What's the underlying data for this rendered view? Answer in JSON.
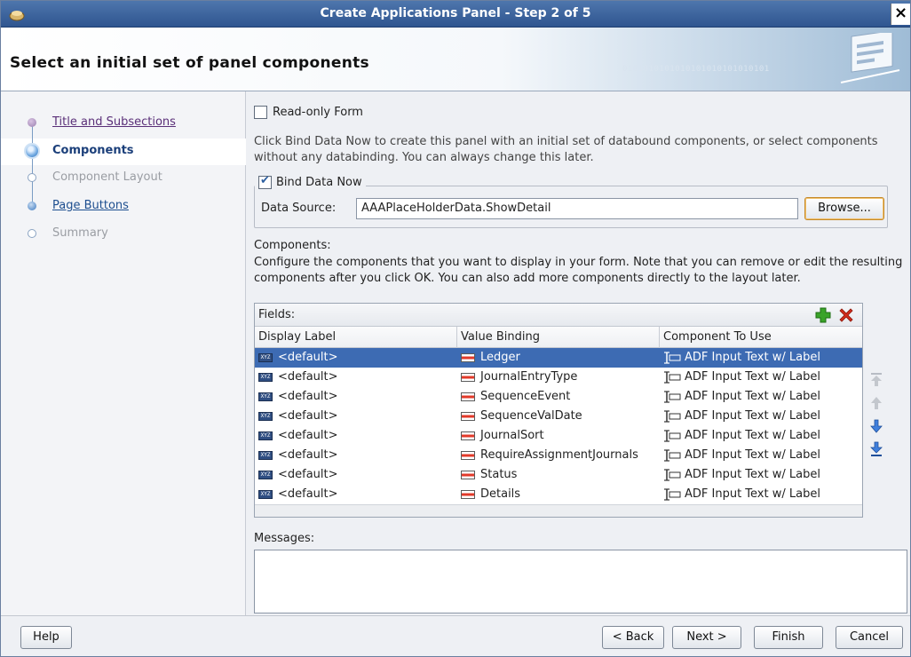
{
  "window": {
    "title": "Create Applications Panel - Step 2 of 5",
    "close_glyph": "×"
  },
  "header": {
    "heading": "Select an initial set of panel components",
    "binary_text": "0101010101010101010101010101"
  },
  "train": {
    "steps": [
      {
        "label": "Title and Subsections",
        "state": "visited"
      },
      {
        "label": "Components",
        "state": "current"
      },
      {
        "label": "Component Layout",
        "state": "disabled"
      },
      {
        "label": "Page Buttons",
        "state": "link"
      },
      {
        "label": "Summary",
        "state": "disabled"
      }
    ]
  },
  "main": {
    "readonly_label": "Read-only Form",
    "readonly_checked": false,
    "description": "Click Bind Data Now to create this panel with an initial set of databound components, or select components without any databinding. You can always change this later.",
    "bind_data_now_label": "Bind Data Now",
    "bind_data_now_checked": true,
    "data_source_label": "Data Source:",
    "data_source_value": "AAAPlaceHolderData.ShowDetail",
    "browse_label": "Browse...",
    "components_label": "Components:",
    "components_description": "Configure the components that you want to display in your form.  Note that you can remove or edit the resulting components after you click OK.  You can also add more components directly to the layout later.",
    "fields_label": "Fields:",
    "columns": [
      "Display Label",
      "Value Binding",
      "Component To Use"
    ],
    "rows": [
      {
        "display": "<default>",
        "binding": "Ledger",
        "component": "ADF Input Text w/ Label",
        "selected": true
      },
      {
        "display": "<default>",
        "binding": "JournalEntryType",
        "component": "ADF Input Text w/ Label",
        "selected": false
      },
      {
        "display": "<default>",
        "binding": "SequenceEvent",
        "component": "ADF Input Text w/ Label",
        "selected": false
      },
      {
        "display": "<default>",
        "binding": "SequenceValDate",
        "component": "ADF Input Text w/ Label",
        "selected": false
      },
      {
        "display": "<default>",
        "binding": "JournalSort",
        "component": "ADF Input Text w/ Label",
        "selected": false
      },
      {
        "display": "<default>",
        "binding": "RequireAssignmentJournals",
        "component": "ADF Input Text w/ Label",
        "selected": false
      },
      {
        "display": "<default>",
        "binding": "Status",
        "component": "ADF Input Text w/ Label",
        "selected": false
      },
      {
        "display": "<default>",
        "binding": "Details",
        "component": "ADF Input Text w/ Label",
        "selected": false
      }
    ],
    "messages_label": "Messages:",
    "messages_text": ""
  },
  "footer": {
    "help": "Help",
    "back": "< Back",
    "next": "Next >",
    "finish": "Finish",
    "cancel": "Cancel"
  },
  "colors": {
    "titlebar": "#2f5590",
    "selection": "#3d6bb3",
    "add_icon": "#3aa329",
    "delete_icon": "#d22b1c",
    "arrow_icon": "#2f6ccf"
  },
  "icons": [
    "app-icon",
    "add-icon",
    "delete-icon",
    "move-top-icon",
    "move-up-icon",
    "move-down-icon",
    "move-bottom-icon",
    "xyz-label-icon",
    "binding-icon",
    "input-text-icon"
  ]
}
